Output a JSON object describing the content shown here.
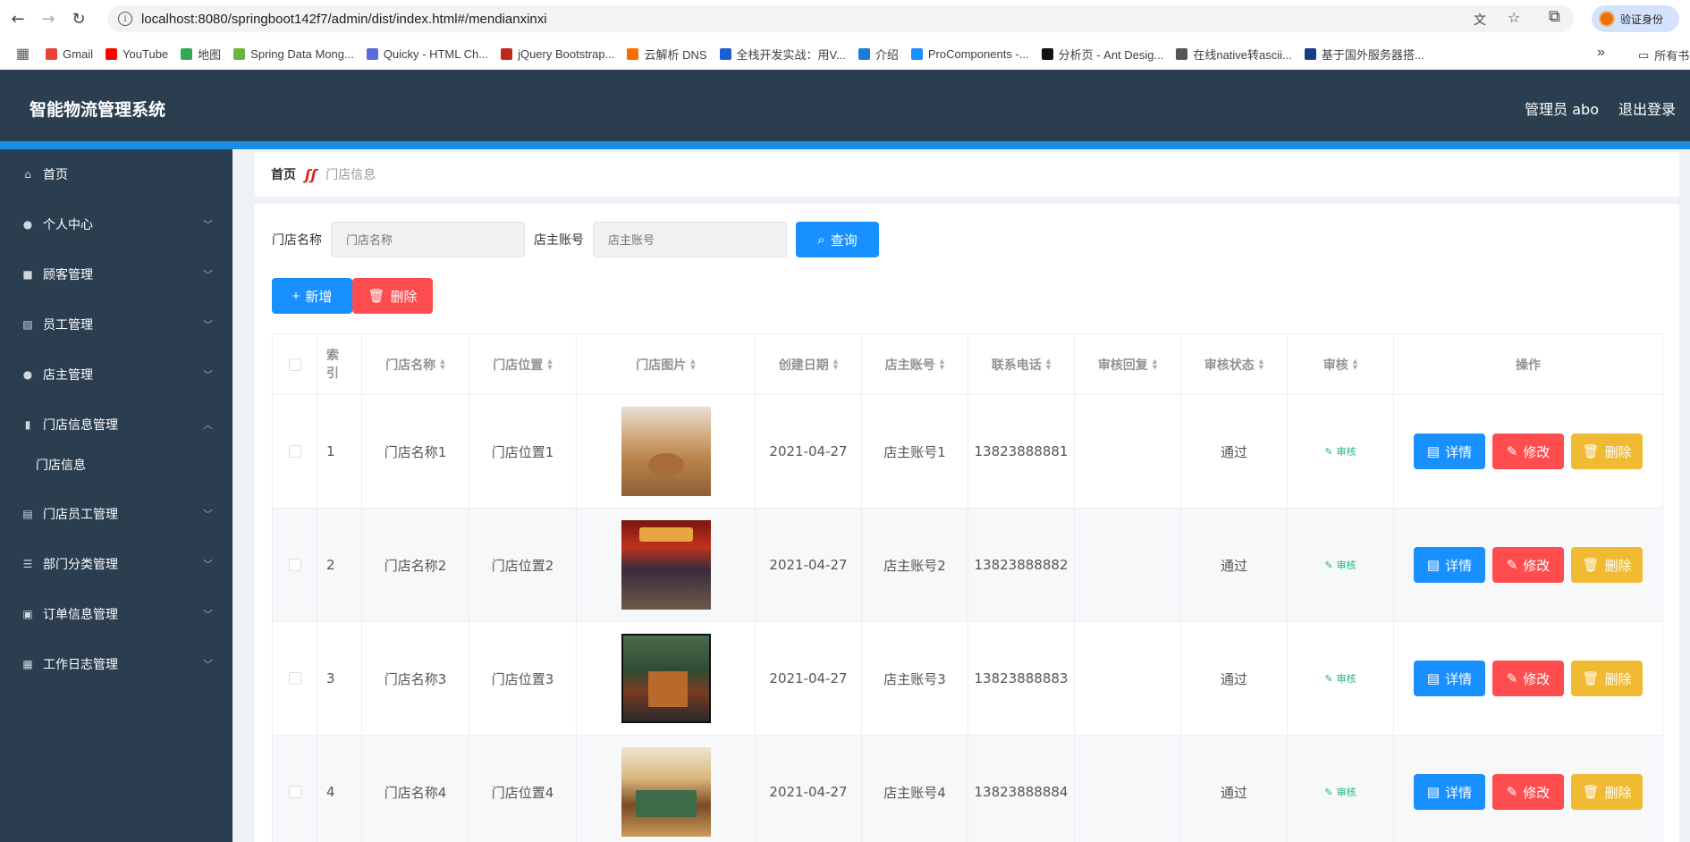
{
  "browser": {
    "url": "localhost:8080/springboot142f7/admin/dist/index.html#/mendianxinxi",
    "verify_label": "验证身份",
    "bookmarks": [
      {
        "label": "Gmail",
        "color": "#ea4335"
      },
      {
        "label": "YouTube",
        "color": "#ff0000"
      },
      {
        "label": "地图",
        "color": "#34a853"
      },
      {
        "label": "Spring Data Mong...",
        "color": "#6db33f"
      },
      {
        "label": "Quicky - HTML Ch...",
        "color": "#5b6bd8"
      },
      {
        "label": "jQuery Bootstrap...",
        "color": "#c0281e"
      },
      {
        "label": "云解析 DNS",
        "color": "#ff6a00"
      },
      {
        "label": "全栈开发实战：用V...",
        "color": "#1a5fd6"
      },
      {
        "label": "介绍",
        "color": "#1e7bd6"
      },
      {
        "label": "ProComponents -...",
        "color": "#1890ff"
      },
      {
        "label": "分析页 - Ant Desig...",
        "color": "#111111"
      },
      {
        "label": "在线native转ascii...",
        "color": "#555555"
      },
      {
        "label": "基于国外服务器搭...",
        "color": "#1a3a8a"
      }
    ],
    "bookmarks_overflow": "»",
    "bookmarks_folder": "所有书"
  },
  "header": {
    "title": "智能物流管理系统",
    "admin_label": "管理员 abo",
    "logout_label": "退出登录"
  },
  "sidebar": {
    "items": [
      {
        "label": "首页",
        "icon": "home-icon",
        "glyph": "⌂"
      },
      {
        "label": "个人中心",
        "icon": "user-icon",
        "glyph": "●"
      },
      {
        "label": "顾客管理",
        "icon": "customer-icon",
        "glyph": "■"
      },
      {
        "label": "员工管理",
        "icon": "chart-icon",
        "glyph": "▨"
      },
      {
        "label": "店主管理",
        "icon": "user-icon",
        "glyph": "●"
      },
      {
        "label": "门店信息管理",
        "icon": "bar-chart-icon",
        "glyph": "▮"
      },
      {
        "label": "门店员工管理",
        "icon": "briefcase-icon",
        "glyph": "▤"
      },
      {
        "label": "部门分类管理",
        "icon": "sliders-icon",
        "glyph": "☰"
      },
      {
        "label": "订单信息管理",
        "icon": "clipboard-icon",
        "glyph": "▣"
      },
      {
        "label": "工作日志管理",
        "icon": "ticket-icon",
        "glyph": "▦"
      }
    ],
    "sub_item": "门店信息"
  },
  "breadcrumb": {
    "home": "首页",
    "separator_icon": "breadcrumb-separator-icon",
    "current": "门店信息"
  },
  "search": {
    "name_label": "门店名称",
    "name_placeholder": "门店名称",
    "account_label": "店主账号",
    "account_placeholder": "店主账号",
    "query_label": "查询"
  },
  "actions": {
    "add_label": "新增",
    "delete_label": "删除"
  },
  "table": {
    "headers": [
      "索引",
      "门店名称",
      "门店位置",
      "门店图片",
      "创建日期",
      "店主账号",
      "联系电话",
      "审核回复",
      "审核状态",
      "审核",
      "操作"
    ],
    "rows": [
      {
        "index": "1",
        "name": "门店名称1",
        "location": "门店位置1",
        "date": "2021-04-27",
        "account": "店主账号1",
        "phone": "13823888881",
        "reply": "",
        "status": "通过",
        "audit": "审核"
      },
      {
        "index": "2",
        "name": "门店名称2",
        "location": "门店位置2",
        "date": "2021-04-27",
        "account": "店主账号2",
        "phone": "13823888882",
        "reply": "",
        "status": "通过",
        "audit": "审核"
      },
      {
        "index": "3",
        "name": "门店名称3",
        "location": "门店位置3",
        "date": "2021-04-27",
        "account": "店主账号3",
        "phone": "13823888883",
        "reply": "",
        "status": "通过",
        "audit": "审核"
      },
      {
        "index": "4",
        "name": "门店名称4",
        "location": "门店位置4",
        "date": "2021-04-27",
        "account": "店主账号4",
        "phone": "13823888884",
        "reply": "",
        "status": "通过",
        "audit": "审核"
      }
    ],
    "op_detail": "详情",
    "op_edit": "修改",
    "op_delete": "删除"
  },
  "colors": {
    "header_bg": "#2b3e50",
    "accent_blue": "#1890ff",
    "danger_red": "#ff4d4f",
    "warning_yellow": "#f0ba32",
    "audit_green": "#26b47a"
  }
}
